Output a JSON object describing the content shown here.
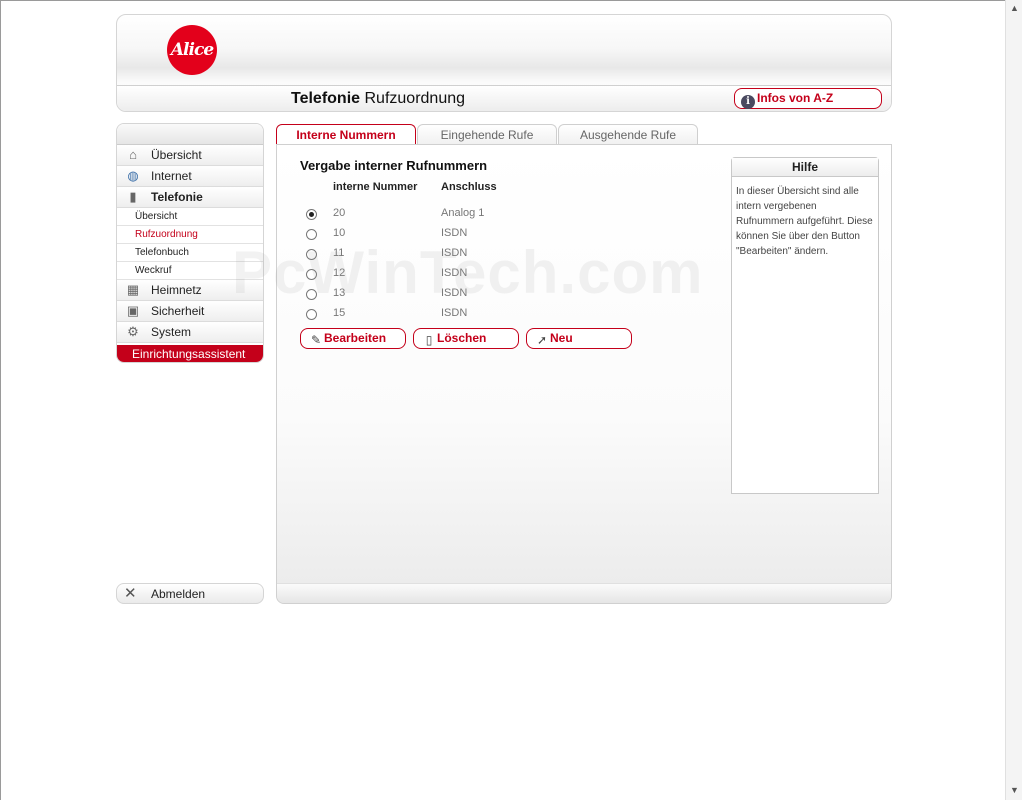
{
  "header": {
    "logo_text": "Alice",
    "title_bold": "Telefonie",
    "title_rest": " Rufzuordnung",
    "infos_label": "Infos von A-Z"
  },
  "nav": {
    "items": [
      {
        "label": "Übersicht",
        "icon": "house-icon"
      },
      {
        "label": "Internet",
        "icon": "globe-icon"
      },
      {
        "label": "Telefonie",
        "icon": "phone-icon"
      },
      {
        "label": "Heimnetz",
        "icon": "network-icon"
      },
      {
        "label": "Sicherheit",
        "icon": "lock-icon"
      },
      {
        "label": "System",
        "icon": "gears-icon"
      }
    ],
    "sub_items": [
      "Übersicht",
      "Rufzuordnung",
      "Telefonbuch",
      "Weckruf"
    ],
    "wizard_label": "Einrichtungsassistent",
    "logout_label": "Abmelden"
  },
  "tabs": [
    "Interne Nummern",
    "Eingehende Rufe",
    "Ausgehende Rufe"
  ],
  "main": {
    "section_title": "Vergabe interner Rufnummern",
    "col_number": "interne Nummer",
    "col_anschluss": "Anschluss",
    "rows": [
      {
        "number": "20",
        "anschluss": "Analog 1",
        "selected": true
      },
      {
        "number": "10",
        "anschluss": "ISDN",
        "selected": false
      },
      {
        "number": "11",
        "anschluss": "ISDN",
        "selected": false
      },
      {
        "number": "12",
        "anschluss": "ISDN",
        "selected": false
      },
      {
        "number": "13",
        "anschluss": "ISDN",
        "selected": false
      },
      {
        "number": "15",
        "anschluss": "ISDN",
        "selected": false
      }
    ],
    "buttons": {
      "edit": "Bearbeiten",
      "delete": "Löschen",
      "new": "Neu"
    }
  },
  "help": {
    "title": "Hilfe",
    "text": "In dieser Übersicht sind alle intern vergebenen Rufnummern aufgeführt. Diese können Sie über den Button \"Bearbeiten\" ändern."
  },
  "watermark": "PcWinTech.com",
  "colors": {
    "accent": "#c4001a",
    "logo": "#e3001b"
  }
}
